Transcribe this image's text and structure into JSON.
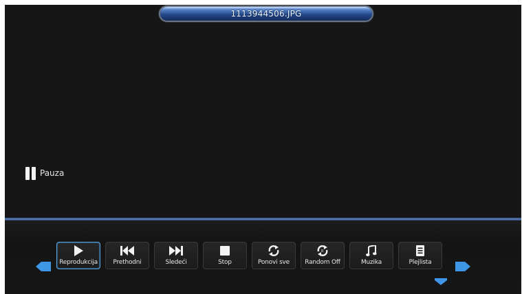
{
  "header": {
    "filename": "1113944506.JPG"
  },
  "status": {
    "label": "Pauza",
    "icon": "pause-icon"
  },
  "toolbar": {
    "items": [
      {
        "label": "Reprodukcija",
        "icon": "play-icon",
        "active": true
      },
      {
        "label": "Prethodni",
        "icon": "previous-icon"
      },
      {
        "label": "Sledeći",
        "icon": "next-icon"
      },
      {
        "label": "Stop",
        "icon": "stop-icon"
      },
      {
        "label": "Ponovi sve",
        "icon": "repeat-icon"
      },
      {
        "label": "Random Off",
        "icon": "shuffle-icon"
      },
      {
        "label": "Muzika",
        "icon": "music-icon"
      },
      {
        "label": "Plejlista",
        "icon": "playlist-icon"
      }
    ]
  },
  "colors": {
    "accent": "#3f8fe0",
    "background": "#161616",
    "active_border": "#58a8e8"
  }
}
